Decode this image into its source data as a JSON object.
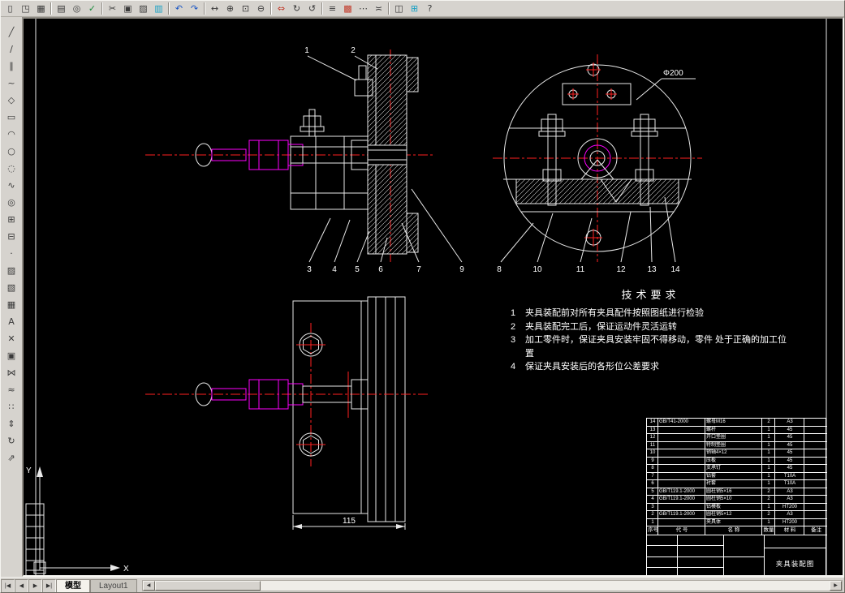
{
  "colors": {
    "canvas_bg": "#000000",
    "drawing_line": "#ffffff",
    "centerline_red": "#ff2020",
    "shaft_magenta": "#ff00ff",
    "chrome": "#d6d3ce"
  },
  "toolbar_top": {
    "buttons": [
      {
        "name": "new",
        "glyph": "▯"
      },
      {
        "name": "open",
        "glyph": "◳"
      },
      {
        "name": "save",
        "glyph": "▦"
      },
      {
        "name": "print",
        "glyph": "▤"
      },
      {
        "name": "print-preview",
        "glyph": "◎"
      },
      {
        "name": "spell-check",
        "glyph": "✓"
      },
      {
        "name": "cut",
        "glyph": "✂"
      },
      {
        "name": "copy",
        "glyph": "▣"
      },
      {
        "name": "paste",
        "glyph": "▨"
      },
      {
        "name": "match-properties",
        "glyph": "▥"
      },
      {
        "name": "undo",
        "glyph": "↶"
      },
      {
        "name": "redo",
        "glyph": "↷"
      },
      {
        "name": "pan",
        "glyph": "↔"
      },
      {
        "name": "zoom-realtime",
        "glyph": "⊕"
      },
      {
        "name": "zoom-window",
        "glyph": "⊡"
      },
      {
        "name": "zoom-previous",
        "glyph": "⊖"
      },
      {
        "name": "distance",
        "glyph": "⇔"
      },
      {
        "name": "redraw",
        "glyph": "↻"
      },
      {
        "name": "regen",
        "glyph": "↺"
      },
      {
        "name": "layers",
        "glyph": "≡"
      },
      {
        "name": "layer-color",
        "glyph": "▩"
      },
      {
        "name": "linetype",
        "glyph": "⋯"
      },
      {
        "name": "lineweight",
        "glyph": "≍"
      },
      {
        "name": "properties",
        "glyph": "◫"
      },
      {
        "name": "design-center",
        "glyph": "⊞"
      },
      {
        "name": "help",
        "glyph": "?"
      }
    ]
  },
  "toolbar_left": {
    "buttons": [
      {
        "name": "line",
        "glyph": "╱"
      },
      {
        "name": "construction-line",
        "glyph": "∕"
      },
      {
        "name": "multiline",
        "glyph": "∥"
      },
      {
        "name": "polyline",
        "glyph": "~"
      },
      {
        "name": "polygon",
        "glyph": "◇"
      },
      {
        "name": "rectangle",
        "glyph": "▭"
      },
      {
        "name": "arc",
        "glyph": "◠"
      },
      {
        "name": "circle",
        "glyph": "○"
      },
      {
        "name": "revision-cloud",
        "glyph": "◌"
      },
      {
        "name": "spline",
        "glyph": "∿"
      },
      {
        "name": "ellipse",
        "glyph": "◎"
      },
      {
        "name": "insert-block",
        "glyph": "⊞"
      },
      {
        "name": "make-block",
        "glyph": "⊟"
      },
      {
        "name": "point",
        "glyph": "·"
      },
      {
        "name": "hatch",
        "glyph": "▨"
      },
      {
        "name": "region",
        "glyph": "▧"
      },
      {
        "name": "table",
        "glyph": "▦"
      },
      {
        "name": "text",
        "glyph": "A"
      },
      {
        "name": "erase",
        "glyph": "✕"
      },
      {
        "name": "copy-object",
        "glyph": "▣"
      },
      {
        "name": "mirror",
        "glyph": "⋈"
      },
      {
        "name": "offset",
        "glyph": "≈"
      },
      {
        "name": "array",
        "glyph": "∷"
      },
      {
        "name": "move",
        "glyph": "⇕"
      },
      {
        "name": "rotate",
        "glyph": "↻"
      },
      {
        "name": "scale",
        "glyph": "⇗"
      }
    ]
  },
  "drawing": {
    "dimensions": {
      "diameter": "Φ200",
      "width": "115"
    },
    "ucs": {
      "x_label": "X",
      "y_label": "Y"
    },
    "callouts_section": [
      "1",
      "2",
      "3",
      "4",
      "5",
      "6",
      "7",
      "9"
    ],
    "callouts_front": [
      "8",
      "10",
      "11",
      "12",
      "13",
      "14"
    ]
  },
  "techreq": {
    "title": "技术要求",
    "items": [
      {
        "no": "1",
        "text": "夹具装配前对所有夹具配件按照图纸进行检验"
      },
      {
        "no": "2",
        "text": "夹具装配完工后，保证运动件灵活运转"
      },
      {
        "no": "3",
        "text": "加工零件时，保证夹具安装牢固不得移动，零件 处于正确的加工位置"
      },
      {
        "no": "4",
        "text": "保证夹具安装后的各形位公差要求"
      }
    ]
  },
  "parts_table": {
    "header": {
      "no": "序号",
      "code": "代 号",
      "name": "名 称",
      "qty": "数量",
      "mat": "材 料",
      "note": "备注"
    },
    "rows": [
      {
        "no": "14",
        "code": "GB/T41-2000",
        "name": "螺母M16",
        "qty": "2",
        "mat": "A3",
        "note": ""
      },
      {
        "no": "13",
        "code": "",
        "name": "螺杆",
        "qty": "1",
        "mat": "45",
        "note": ""
      },
      {
        "no": "12",
        "code": "",
        "name": "开口垫圈",
        "qty": "1",
        "mat": "45",
        "note": ""
      },
      {
        "no": "11",
        "code": "",
        "name": "特制垫圈",
        "qty": "1",
        "mat": "45",
        "note": ""
      },
      {
        "no": "10",
        "code": "",
        "name": "销轴4×12",
        "qty": "1",
        "mat": "45",
        "note": ""
      },
      {
        "no": "9",
        "code": "",
        "name": "压板",
        "qty": "1",
        "mat": "45",
        "note": ""
      },
      {
        "no": "8",
        "code": "",
        "name": "支承钉",
        "qty": "1",
        "mat": "45",
        "note": ""
      },
      {
        "no": "7",
        "code": "",
        "name": "钻套",
        "qty": "1",
        "mat": "T10A",
        "note": ""
      },
      {
        "no": "6",
        "code": "",
        "name": "衬套",
        "qty": "1",
        "mat": "T10A",
        "note": ""
      },
      {
        "no": "5",
        "code": "GB/T119.1-2000",
        "name": "圆柱销5×16",
        "qty": "2",
        "mat": "A3",
        "note": ""
      },
      {
        "no": "4",
        "code": "GB/T119.1-2000",
        "name": "圆柱销5×10",
        "qty": "2",
        "mat": "A3",
        "note": ""
      },
      {
        "no": "3",
        "code": "",
        "name": "钻模板",
        "qty": "1",
        "mat": "HT200",
        "note": ""
      },
      {
        "no": "2",
        "code": "GB/T119.1-2000",
        "name": "圆柱销5×12",
        "qty": "2",
        "mat": "A3",
        "note": ""
      },
      {
        "no": "1",
        "code": "",
        "name": "夹具体",
        "qty": "1",
        "mat": "HT200",
        "note": ""
      }
    ],
    "title_block": {
      "drawing_name": "夹具装配图"
    }
  },
  "tabs": {
    "nav_first": "|◀",
    "nav_prev": "◀",
    "nav_next": "▶",
    "nav_last": "▶|",
    "model_tab": "模型",
    "layout_tab": "Layout1",
    "scroll_left": "◀",
    "scroll_right": "▶"
  }
}
